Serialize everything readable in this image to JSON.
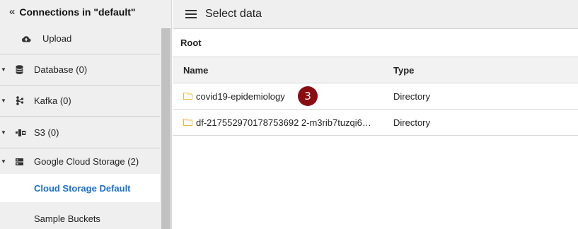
{
  "sidebar": {
    "title": "Connections in \"default\"",
    "back_glyph": "«",
    "upload_label": "Upload",
    "items": [
      {
        "label": "Database (0)",
        "icon": "database-icon"
      },
      {
        "label": "Kafka (0)",
        "icon": "kafka-icon"
      },
      {
        "label": "S3 (0)",
        "icon": "s3-icon"
      },
      {
        "label": "Google Cloud Storage (2)",
        "icon": "storage-icon"
      }
    ],
    "children": [
      {
        "label": "Cloud Storage Default",
        "active": true
      },
      {
        "label": "Sample Buckets",
        "active": false
      }
    ]
  },
  "header": {
    "title": "Select data"
  },
  "breadcrumb": "Root",
  "table": {
    "columns": [
      "Name",
      "Type"
    ],
    "rows": [
      {
        "name": "covid19-epidemiology",
        "type": "Directory"
      },
      {
        "name": "df-217552970178753692 2-m3rib7tuzqi6…",
        "type": "Directory"
      }
    ]
  },
  "badge": "3",
  "colors": {
    "accent": "#1a6fd1",
    "badge": "#8b0d12",
    "folder": "#e8b93a"
  }
}
